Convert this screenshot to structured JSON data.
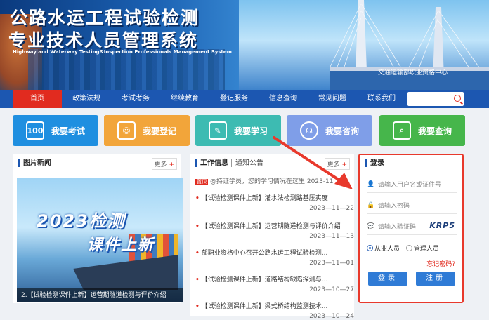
{
  "header": {
    "title_line1": "公路水运工程试验检测",
    "title_line2": "专业技术人员管理系统",
    "subtitle": "Highway and Waterway Testing&Inspection Professionals Management System",
    "ministry": "交通运输部职业资格中心"
  },
  "nav": {
    "items": [
      "首页",
      "政策法规",
      "考试考务",
      "继续教育",
      "登记服务",
      "信息查询",
      "常见问题",
      "联系我们"
    ],
    "active": "首页",
    "search_placeholder": ""
  },
  "tiles": [
    {
      "label": "我要考试",
      "icon": "monitor-100-icon",
      "icon_text": "100",
      "color": "#1f8fe0"
    },
    {
      "label": "我要登记",
      "icon": "person-card-icon",
      "icon_text": "",
      "color": "#f2a53a"
    },
    {
      "label": "我要学习",
      "icon": "pen-person-icon",
      "icon_text": "",
      "color": "#3dbbb2"
    },
    {
      "label": "我要咨询",
      "icon": "headset-icon",
      "icon_text": "",
      "color": "#7f9ee8"
    },
    {
      "label": "我要查询",
      "icon": "search-doc-icon",
      "icon_text": "",
      "color": "#46b64b"
    }
  ],
  "picnews": {
    "heading": "图片新闻",
    "more": "更多",
    "image_text1": "2023检测",
    "image_text2": "课件上新",
    "caption": "2.【试验检测课件上新】运营期隧道检测与评价介绍"
  },
  "worknews": {
    "tab1": "工作信息",
    "tab2": "通知公告",
    "more": "更多",
    "badge": "置顶",
    "top_item": "@持证学员，您的学习情况在这里",
    "top_date": "2023-11",
    "items": [
      {
        "title": "【试验检测课件上新】灌水法检测路基压实度",
        "date": "2023—11—22"
      },
      {
        "title": "【试验检测课件上新】运营期隧道检测与评价介绍",
        "date": "2023—11—13"
      },
      {
        "title": "部职业资格中心召开公路水运工程试验检测...",
        "date": "2023—11—01"
      },
      {
        "title": "【试验检测课件上新】道路结构缺陷探测与...",
        "date": "2023—10—27"
      },
      {
        "title": "【试验检测课件上新】梁式桥结构监测技术...",
        "date": "2023—10—24"
      }
    ]
  },
  "login": {
    "heading": "登录",
    "username_placeholder": "请输入用户名或证件号",
    "password_placeholder": "请输入密码",
    "captcha_placeholder": "请输入验证码",
    "captcha_text": "KRP5",
    "role1": "从业人员",
    "role2": "管理人员",
    "forgot": "忘记密码?",
    "login_btn": "登录",
    "register_btn": "注册"
  },
  "colors": {
    "nav": "#1c57b1",
    "accent": "#e12b1f",
    "highlight": "#e8392c",
    "button": "#2f7bd6"
  }
}
